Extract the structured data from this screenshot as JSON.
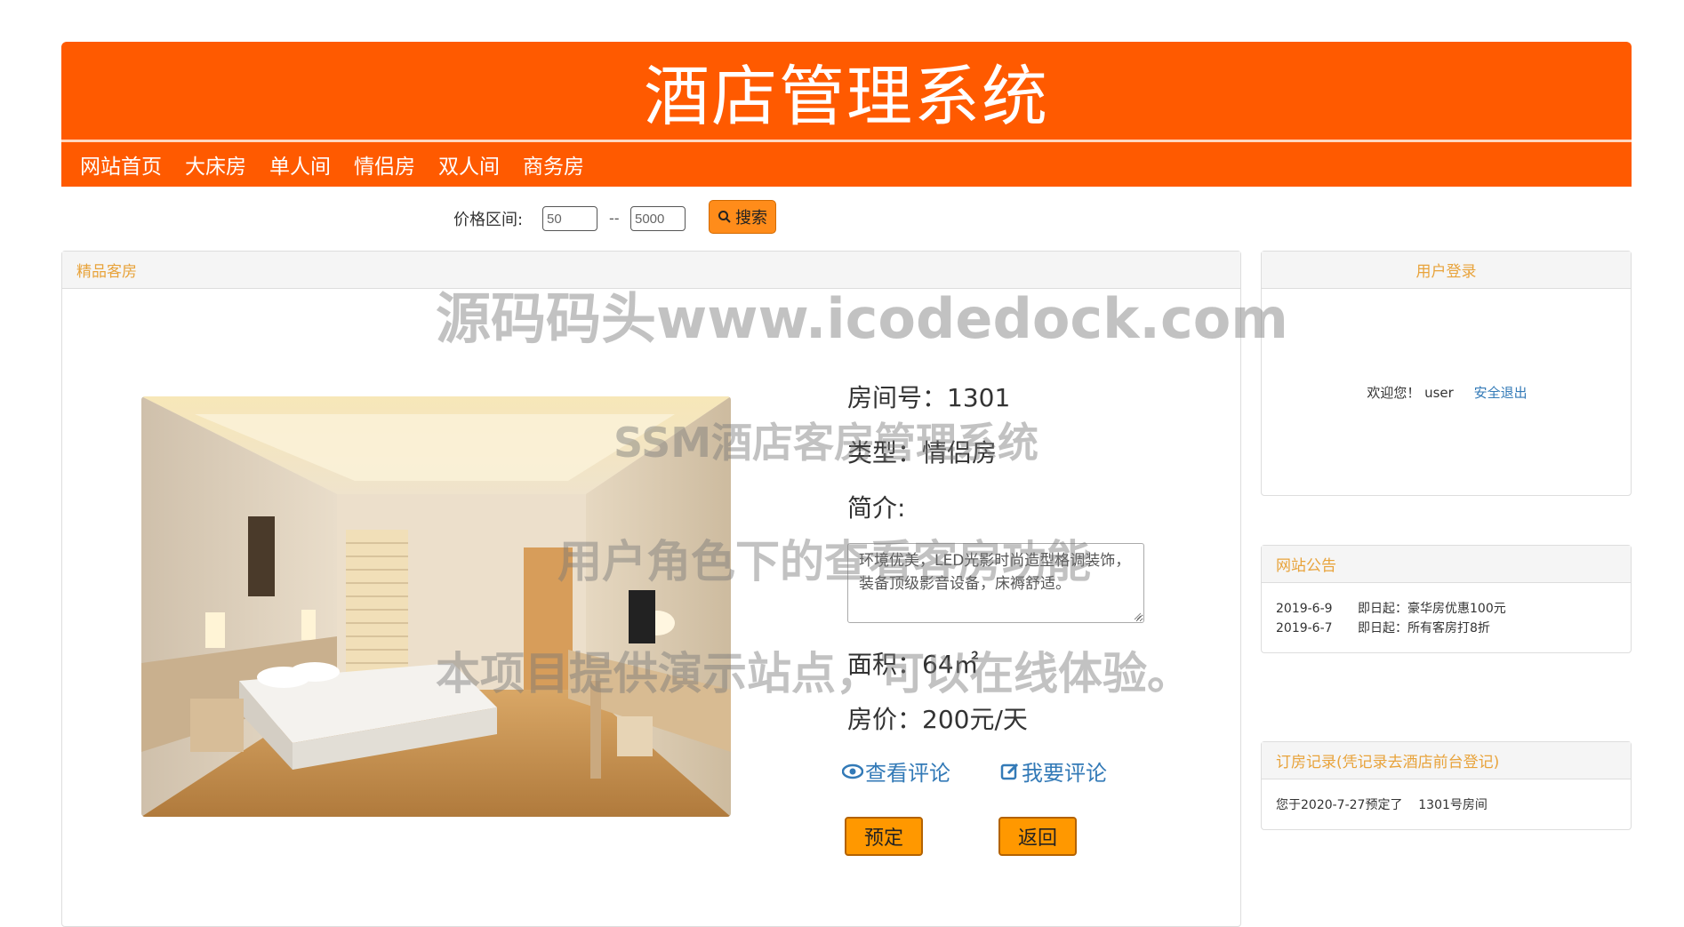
{
  "header": {
    "title": "酒店管理系统",
    "nav": [
      "网站首页",
      "大床房",
      "单人间",
      "情侣房",
      "双人间",
      "商务房"
    ]
  },
  "search": {
    "label": "价格区间:",
    "min_value": "50",
    "max_value": "5000",
    "separator": "--",
    "button_label": "搜索"
  },
  "main_panel": {
    "title": "精品客房",
    "room": {
      "number": "房间号：1301",
      "type": "类型：情侣房",
      "intro_label": "简介:",
      "intro_text": "环境优美，LED光影时尚造型格调装饰，装备顶级影音设备，床褥舒适。",
      "area": "面积：64㎡",
      "price": "房价：200元/天"
    },
    "view_comments": "查看评论",
    "write_comment": "我要评论",
    "book_button": "预定",
    "back_button": "返回"
  },
  "login_panel": {
    "title": "用户登录",
    "welcome": "欢迎您！ user",
    "logout": "安全退出"
  },
  "notice_panel": {
    "title": "网站公告",
    "items": [
      {
        "date": "2019-6-9",
        "text": "即日起：豪华房优惠100元"
      },
      {
        "date": "2019-6-7",
        "text": "即日起：所有客房打8折"
      }
    ]
  },
  "booking_panel": {
    "title": "订房记录(凭记录去酒店前台登记)",
    "record": "您于2020-7-27预定了    1301号房间"
  },
  "watermarks": {
    "line1": "源码码头www.icodedock.com",
    "line2": "SSM酒店客房管理系统",
    "line3": "用户角色下的查看客房功能",
    "line4": "本项目提供演示站点，可以在线体验。"
  }
}
